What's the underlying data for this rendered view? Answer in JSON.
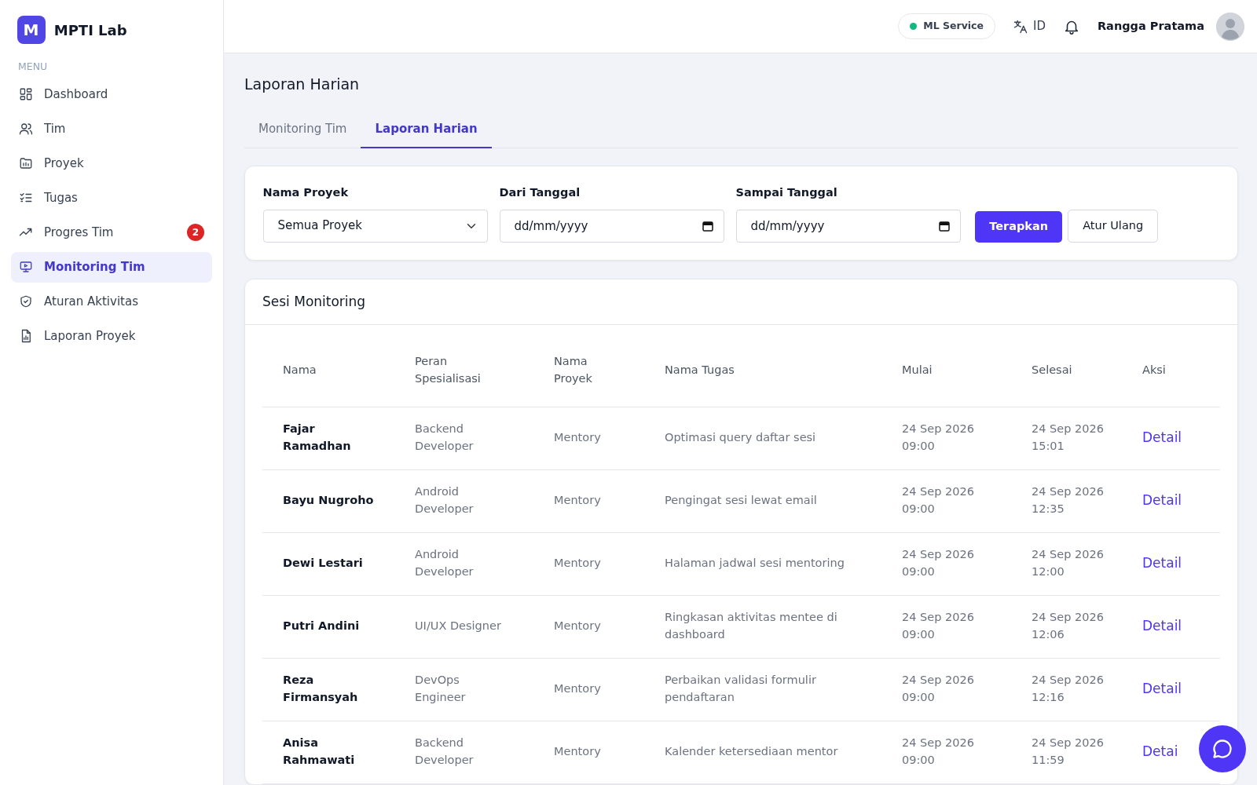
{
  "brand": {
    "logo": "M",
    "name": "MPTI Lab"
  },
  "sidebar": {
    "heading": "MENU",
    "items": [
      {
        "label": "Dashboard",
        "selected": false
      },
      {
        "label": "Tim",
        "selected": false
      },
      {
        "label": "Proyek",
        "selected": false
      },
      {
        "label": "Tugas",
        "selected": false
      },
      {
        "label": "Progres Tim",
        "selected": false,
        "badge": "2"
      },
      {
        "label": "Monitoring Tim",
        "selected": true
      },
      {
        "label": "Aturan Aktivitas",
        "selected": false
      },
      {
        "label": "Laporan Proyek",
        "selected": false
      }
    ]
  },
  "header": {
    "service": {
      "label": "ML Service",
      "color": "#10b981"
    },
    "language": "ID",
    "user": "Rangga Pratama"
  },
  "page_title": "Laporan Harian",
  "tabs": [
    {
      "label": "Monitoring Tim",
      "selected": false
    },
    {
      "label": "Laporan Harian",
      "selected": true
    }
  ],
  "filters": {
    "fields": [
      {
        "kind": "select",
        "label": "Nama Proyek",
        "value": "Semua Proyek"
      },
      {
        "kind": "date",
        "label": "Dari Tanggal",
        "placeholder": "dd/mm/yyyy"
      },
      {
        "kind": "date",
        "label": "Sampai Tanggal",
        "placeholder": "dd/mm/yyyy"
      }
    ],
    "apply": "Terapkan",
    "reset": "Atur Ulang"
  },
  "table": {
    "title": "Sesi Monitoring",
    "columns": [
      "Nama",
      "Peran Spesialisasi",
      "Nama Proyek",
      "Nama Tugas",
      "Mulai",
      "Selesai",
      "Aksi"
    ],
    "rows": [
      [
        "Fajar Ramadhan",
        "Backend Developer",
        "Mentory",
        "Optimasi query daftar sesi",
        "24 Sep 2026 09:00",
        "24 Sep 2026 15:01",
        "Detail"
      ],
      [
        "Bayu Nugroho",
        "Android Developer",
        "Mentory",
        "Pengingat sesi lewat email",
        "24 Sep 2026 09:00",
        "24 Sep 2026 12:35",
        "Detail"
      ],
      [
        "Dewi Lestari",
        "Android Developer",
        "Mentory",
        "Halaman jadwal sesi mentoring",
        "24 Sep 2026 09:00",
        "24 Sep 2026 12:00",
        "Detail"
      ],
      [
        "Putri Andini",
        "UI/UX Designer",
        "Mentory",
        "Ringkasan aktivitas mentee di dashboard",
        "24 Sep 2026 09:00",
        "24 Sep 2026 12:06",
        "Detail"
      ],
      [
        "Reza Firmansyah",
        "DevOps Engineer",
        "Mentory",
        "Perbaikan validasi formulir pendaftaran",
        "24 Sep 2026 09:00",
        "24 Sep 2026 12:16",
        "Detail"
      ],
      [
        "Anisa Rahmawati",
        "Backend Developer",
        "Mentory",
        "Kalender ketersediaan mentor",
        "24 Sep 2026 09:00",
        "24 Sep 2026 11:59",
        "Detai"
      ]
    ]
  }
}
